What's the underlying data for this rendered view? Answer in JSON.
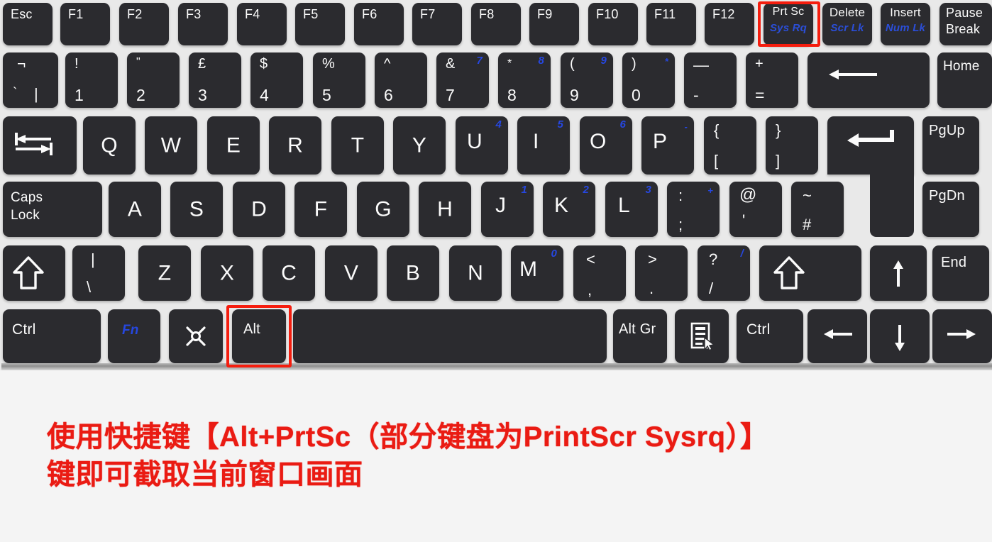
{
  "caption": {
    "line1": "使用快捷键【Alt+PrtSc（部分键盘为PrintScr Sysrq）】",
    "line2": "键即可截取当前窗口画面",
    "color": "#ea1b13"
  },
  "colors": {
    "key_face": "#2b2b2f",
    "key_text": "#fbfbfb",
    "blue_legend": "#2647e0",
    "highlight": "#f51d0e",
    "deck": "#e9e9e9",
    "page_background": "#f4f4f4"
  },
  "highlights": [
    {
      "name": "prt-sc-highlight",
      "target": "Prt Sc"
    },
    {
      "name": "alt-highlight",
      "target": "Alt"
    }
  ],
  "keyboard": {
    "layout": "UK",
    "rows": [
      {
        "name": "function-row",
        "keys": [
          {
            "id": "esc",
            "main": "Esc",
            "style": "tl"
          },
          {
            "id": "f1",
            "main": "F1",
            "style": "tl"
          },
          {
            "id": "f2",
            "main": "F2",
            "style": "tl"
          },
          {
            "id": "f3",
            "main": "F3",
            "style": "tl"
          },
          {
            "id": "f4",
            "main": "F4",
            "style": "tl"
          },
          {
            "id": "f5",
            "main": "F5",
            "style": "tl"
          },
          {
            "id": "f6",
            "main": "F6",
            "style": "tl"
          },
          {
            "id": "f7",
            "main": "F7",
            "style": "tl"
          },
          {
            "id": "f8",
            "main": "F8",
            "style": "tl"
          },
          {
            "id": "f9",
            "main": "F9",
            "style": "tl"
          },
          {
            "id": "f10",
            "main": "F10",
            "style": "tl"
          },
          {
            "id": "f11",
            "main": "F11",
            "style": "tl"
          },
          {
            "id": "f12",
            "main": "F12",
            "style": "tl"
          },
          {
            "id": "prtsc",
            "main": "Prt Sc",
            "sub": "Sys Rq",
            "style": "tl-sub",
            "highlighted": true
          },
          {
            "id": "delete",
            "main": "Delete",
            "sub": "Scr Lk",
            "style": "tl-sub"
          },
          {
            "id": "insert",
            "main": "Insert",
            "sub": "Num Lk",
            "style": "tl-sub"
          },
          {
            "id": "pause",
            "main": "Pause",
            "sub2": "Break",
            "style": "two-line-white"
          }
        ]
      },
      {
        "name": "number-row",
        "keys": [
          {
            "id": "backquote",
            "up": "¬",
            "lo2": "`",
            "lo": "|",
            "style": "special-backquote"
          },
          {
            "id": "d1",
            "up": "!",
            "lo": "1"
          },
          {
            "id": "d2",
            "up": "\"",
            "lo": "2"
          },
          {
            "id": "d3",
            "up": "£",
            "lo": "3"
          },
          {
            "id": "d4",
            "up": "$",
            "lo": "4"
          },
          {
            "id": "d5",
            "up": "%",
            "lo": "5"
          },
          {
            "id": "d6",
            "up": "^",
            "lo": "6"
          },
          {
            "id": "d7",
            "up": "&",
            "lo": "7",
            "blue": "7"
          },
          {
            "id": "d8",
            "up": "*",
            "lo": "8",
            "blue": "8"
          },
          {
            "id": "d9",
            "up": "(",
            "lo": "9",
            "blue": "9"
          },
          {
            "id": "d0",
            "up": ")",
            "lo": "0",
            "blue": "*"
          },
          {
            "id": "minus",
            "up": "—",
            "lo": "-"
          },
          {
            "id": "equals",
            "up": "+",
            "lo": "="
          },
          {
            "id": "backspace",
            "icon": "backspace-arrow-icon"
          },
          {
            "id": "home",
            "main": "Home",
            "style": "tl"
          }
        ]
      },
      {
        "name": "qwerty-row",
        "keys": [
          {
            "id": "tab",
            "icon": "tab-arrows-icon"
          },
          {
            "id": "q",
            "main": "Q"
          },
          {
            "id": "w",
            "main": "W"
          },
          {
            "id": "e",
            "main": "E"
          },
          {
            "id": "r",
            "main": "R"
          },
          {
            "id": "t",
            "main": "T"
          },
          {
            "id": "y",
            "main": "Y"
          },
          {
            "id": "u",
            "main": "U",
            "blue": "4"
          },
          {
            "id": "i",
            "main": "I",
            "blue": "5"
          },
          {
            "id": "o",
            "main": "O",
            "blue": "6"
          },
          {
            "id": "p",
            "main": "P",
            "blue": "-"
          },
          {
            "id": "lbracket",
            "up": "{",
            "lo": "["
          },
          {
            "id": "rbracket",
            "up": "}",
            "lo": "]"
          },
          {
            "id": "enter",
            "icon": "enter-arrow-icon"
          },
          {
            "id": "pgup",
            "main": "PgUp",
            "style": "tl"
          }
        ]
      },
      {
        "name": "home-row",
        "keys": [
          {
            "id": "capslock",
            "main": "Caps",
            "sub2": "Lock",
            "style": "two-line-white"
          },
          {
            "id": "a",
            "main": "A"
          },
          {
            "id": "s",
            "main": "S"
          },
          {
            "id": "d",
            "main": "D"
          },
          {
            "id": "f",
            "main": "F"
          },
          {
            "id": "g",
            "main": "G"
          },
          {
            "id": "h",
            "main": "H"
          },
          {
            "id": "j",
            "main": "J",
            "blue": "1"
          },
          {
            "id": "k",
            "main": "K",
            "blue": "2"
          },
          {
            "id": "l",
            "main": "L",
            "blue": "3"
          },
          {
            "id": "semicolon",
            "up": ":",
            "lo": ";",
            "blue": "+"
          },
          {
            "id": "quote",
            "up": "@",
            "lo": "'"
          },
          {
            "id": "hash",
            "up": "~",
            "lo": "#"
          },
          {
            "id": "pgdn",
            "main": "PgDn",
            "style": "tl"
          }
        ]
      },
      {
        "name": "shift-row",
        "keys": [
          {
            "id": "lshift",
            "icon": "shift-arrow-icon"
          },
          {
            "id": "backslash",
            "up": "|",
            "lo": "\\"
          },
          {
            "id": "z",
            "main": "Z"
          },
          {
            "id": "x",
            "main": "X"
          },
          {
            "id": "c",
            "main": "C"
          },
          {
            "id": "v",
            "main": "V"
          },
          {
            "id": "b",
            "main": "B"
          },
          {
            "id": "n",
            "main": "N"
          },
          {
            "id": "m",
            "main": "M",
            "blue": "0"
          },
          {
            "id": "comma",
            "up": "<",
            "lo": ","
          },
          {
            "id": "period",
            "up": ">",
            "lo": "."
          },
          {
            "id": "slash",
            "up": "?",
            "lo": "/",
            "blue": "/"
          },
          {
            "id": "rshift",
            "icon": "shift-arrow-icon"
          },
          {
            "id": "uparrow",
            "icon": "arrow-up-icon"
          },
          {
            "id": "end",
            "main": "End",
            "style": "tl"
          }
        ]
      },
      {
        "name": "bottom-row",
        "keys": [
          {
            "id": "lctrl",
            "main": "Ctrl",
            "style": "tl"
          },
          {
            "id": "fn",
            "main": "Fn",
            "style": "fn-blue"
          },
          {
            "id": "win",
            "icon": "windows-icon"
          },
          {
            "id": "lalt",
            "main": "Alt",
            "style": "tl",
            "highlighted": true
          },
          {
            "id": "space",
            "main": ""
          },
          {
            "id": "altgr",
            "main": "Alt Gr",
            "style": "tl"
          },
          {
            "id": "menu",
            "icon": "context-menu-icon"
          },
          {
            "id": "rctrl",
            "main": "Ctrl",
            "style": "tl"
          },
          {
            "id": "leftarrow",
            "icon": "arrow-left-icon"
          },
          {
            "id": "downarrow",
            "icon": "arrow-down-icon"
          },
          {
            "id": "rightarrow",
            "icon": "arrow-right-icon"
          }
        ]
      }
    ]
  }
}
